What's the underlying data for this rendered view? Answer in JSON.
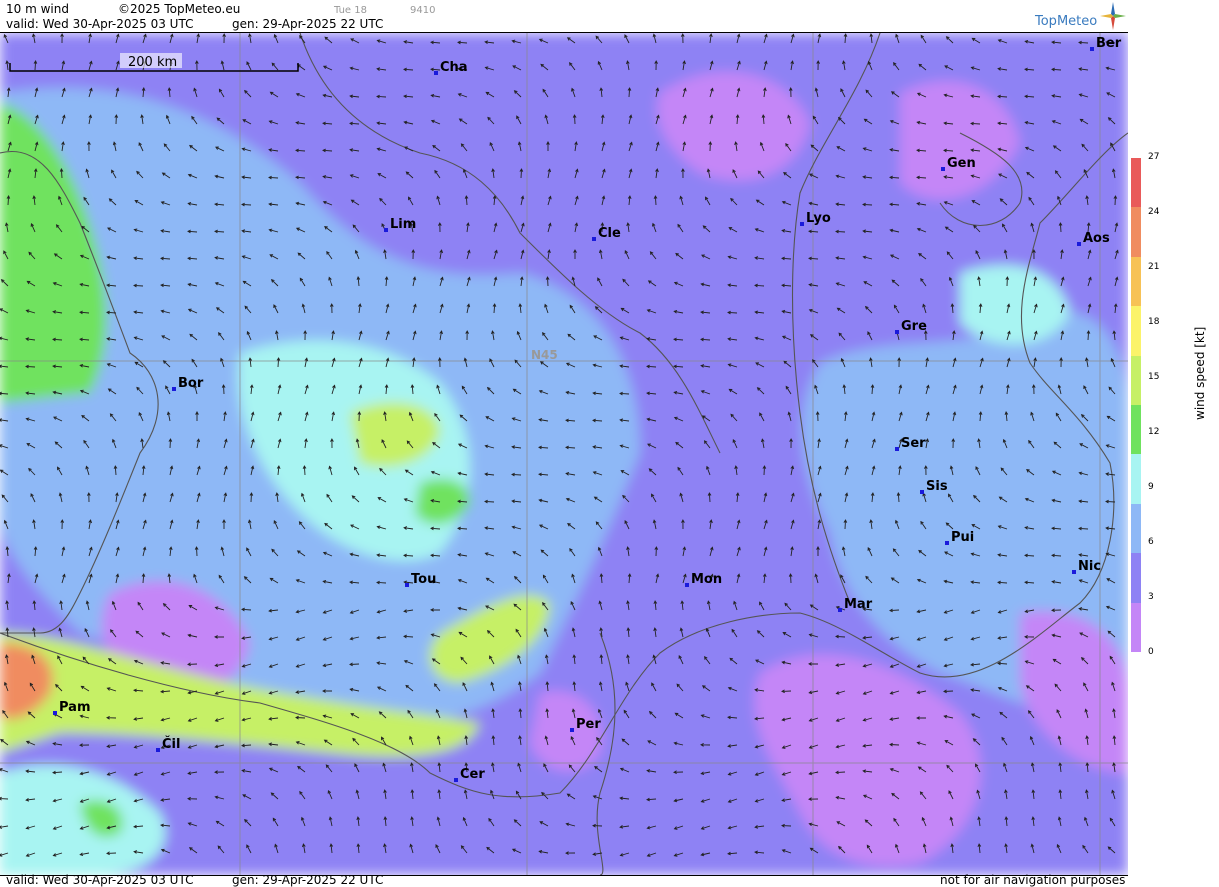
{
  "header": {
    "product": "10 m wind",
    "copyright": "©2025 TopMeteo.eu",
    "valid": "valid:  Wed  30-Apr-2025  03 UTC",
    "gen": "gen: 29-Apr-2025 22 UTC",
    "day_tag": "Tue 18",
    "code": "9410",
    "logo_text": "TopMeteo"
  },
  "footer": {
    "valid": "valid:  Wed  30-Apr-2025  03 UTC",
    "gen": "gen: 29-Apr-2025 22 UTC",
    "disclaimer": "not for air navigation purposes"
  },
  "scale_bar": {
    "label": "200 km"
  },
  "grid_label": "N45",
  "legend": {
    "title": "wind speed [kt]",
    "ticks": [
      "27",
      "24",
      "21",
      "18",
      "15",
      "12",
      "9",
      "6",
      "3",
      "0"
    ],
    "colors": [
      "#e95a5a",
      "#f08c60",
      "#f7c256",
      "#fbf36a",
      "#c6f066",
      "#6fe25e",
      "#a8f4f2",
      "#8eb8f6",
      "#8e82f4",
      "#c486f7"
    ]
  },
  "cities": [
    {
      "name": "Cha"
    },
    {
      "name": "Ber"
    },
    {
      "name": "Gen"
    },
    {
      "name": "Lim"
    },
    {
      "name": "Cle"
    },
    {
      "name": "Lyo"
    },
    {
      "name": "Aos"
    },
    {
      "name": "Gre"
    },
    {
      "name": "Bor"
    },
    {
      "name": "Ser"
    },
    {
      "name": "Sis"
    },
    {
      "name": "Pui"
    },
    {
      "name": "Nic"
    },
    {
      "name": "Tou"
    },
    {
      "name": "Mon"
    },
    {
      "name": "Mar"
    },
    {
      "name": "Pam"
    },
    {
      "name": "Per"
    },
    {
      "name": "Čil"
    },
    {
      "name": "Cer"
    }
  ]
}
